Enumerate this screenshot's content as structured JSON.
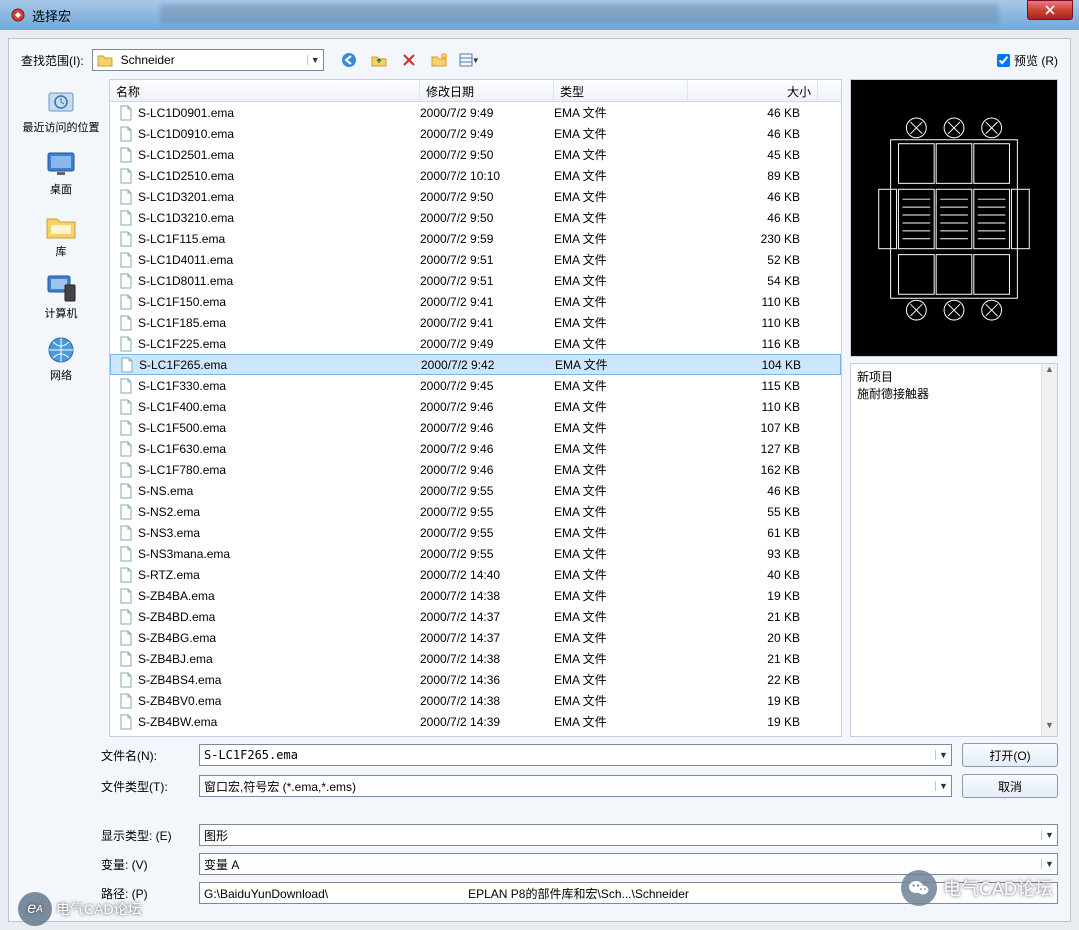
{
  "window": {
    "title": "选择宏"
  },
  "toolbar": {
    "lookin_label": "查找范围(I):",
    "location": "Schneider",
    "preview_label": "预览 (R)",
    "preview_checked": true,
    "icons": {
      "back": "back-icon",
      "up": "up-icon",
      "delete": "delete-icon",
      "newfolder": "newfolder-icon",
      "views": "views-icon"
    }
  },
  "places": [
    {
      "id": "recent",
      "label": "最近访问的位置"
    },
    {
      "id": "desktop",
      "label": "桌面"
    },
    {
      "id": "libraries",
      "label": "库"
    },
    {
      "id": "computer",
      "label": "计算机"
    },
    {
      "id": "network",
      "label": "网络"
    }
  ],
  "columns": {
    "name": "名称",
    "date": "修改日期",
    "type": "类型",
    "size": "大小"
  },
  "files": [
    {
      "name": "S-LC1D0901.ema",
      "date": "2000/7/2 9:49",
      "type": "EMA 文件",
      "size": "46 KB"
    },
    {
      "name": "S-LC1D0910.ema",
      "date": "2000/7/2 9:49",
      "type": "EMA 文件",
      "size": "46 KB"
    },
    {
      "name": "S-LC1D2501.ema",
      "date": "2000/7/2 9:50",
      "type": "EMA 文件",
      "size": "45 KB"
    },
    {
      "name": "S-LC1D2510.ema",
      "date": "2000/7/2 10:10",
      "type": "EMA 文件",
      "size": "89 KB"
    },
    {
      "name": "S-LC1D3201.ema",
      "date": "2000/7/2 9:50",
      "type": "EMA 文件",
      "size": "46 KB"
    },
    {
      "name": "S-LC1D3210.ema",
      "date": "2000/7/2 9:50",
      "type": "EMA 文件",
      "size": "46 KB"
    },
    {
      "name": "S-LC1F115.ema",
      "date": "2000/7/2 9:59",
      "type": "EMA 文件",
      "size": "230 KB"
    },
    {
      "name": "S-LC1D4011.ema",
      "date": "2000/7/2 9:51",
      "type": "EMA 文件",
      "size": "52 KB"
    },
    {
      "name": "S-LC1D8011.ema",
      "date": "2000/7/2 9:51",
      "type": "EMA 文件",
      "size": "54 KB"
    },
    {
      "name": "S-LC1F150.ema",
      "date": "2000/7/2 9:41",
      "type": "EMA 文件",
      "size": "110 KB"
    },
    {
      "name": "S-LC1F185.ema",
      "date": "2000/7/2 9:41",
      "type": "EMA 文件",
      "size": "110 KB"
    },
    {
      "name": "S-LC1F225.ema",
      "date": "2000/7/2 9:49",
      "type": "EMA 文件",
      "size": "116 KB"
    },
    {
      "name": "S-LC1F265.ema",
      "date": "2000/7/2 9:42",
      "type": "EMA 文件",
      "size": "104 KB",
      "selected": true
    },
    {
      "name": "S-LC1F330.ema",
      "date": "2000/7/2 9:45",
      "type": "EMA 文件",
      "size": "115 KB"
    },
    {
      "name": "S-LC1F400.ema",
      "date": "2000/7/2 9:46",
      "type": "EMA 文件",
      "size": "110 KB"
    },
    {
      "name": "S-LC1F500.ema",
      "date": "2000/7/2 9:46",
      "type": "EMA 文件",
      "size": "107 KB"
    },
    {
      "name": "S-LC1F630.ema",
      "date": "2000/7/2 9:46",
      "type": "EMA 文件",
      "size": "127 KB"
    },
    {
      "name": "S-LC1F780.ema",
      "date": "2000/7/2 9:46",
      "type": "EMA 文件",
      "size": "162 KB"
    },
    {
      "name": "S-NS.ema",
      "date": "2000/7/2 9:55",
      "type": "EMA 文件",
      "size": "46 KB"
    },
    {
      "name": "S-NS2.ema",
      "date": "2000/7/2 9:55",
      "type": "EMA 文件",
      "size": "55 KB"
    },
    {
      "name": "S-NS3.ema",
      "date": "2000/7/2 9:55",
      "type": "EMA 文件",
      "size": "61 KB"
    },
    {
      "name": "S-NS3mana.ema",
      "date": "2000/7/2 9:55",
      "type": "EMA 文件",
      "size": "93 KB"
    },
    {
      "name": "S-RTZ.ema",
      "date": "2000/7/2 14:40",
      "type": "EMA 文件",
      "size": "40 KB"
    },
    {
      "name": "S-ZB4BA.ema",
      "date": "2000/7/2 14:38",
      "type": "EMA 文件",
      "size": "19 KB"
    },
    {
      "name": "S-ZB4BD.ema",
      "date": "2000/7/2 14:37",
      "type": "EMA 文件",
      "size": "21 KB"
    },
    {
      "name": "S-ZB4BG.ema",
      "date": "2000/7/2 14:37",
      "type": "EMA 文件",
      "size": "20 KB"
    },
    {
      "name": "S-ZB4BJ.ema",
      "date": "2000/7/2 14:38",
      "type": "EMA 文件",
      "size": "21 KB"
    },
    {
      "name": "S-ZB4BS4.ema",
      "date": "2000/7/2 14:36",
      "type": "EMA 文件",
      "size": "22 KB"
    },
    {
      "name": "S-ZB4BV0.ema",
      "date": "2000/7/2 14:38",
      "type": "EMA 文件",
      "size": "19 KB"
    },
    {
      "name": "S-ZB4BW.ema",
      "date": "2000/7/2 14:39",
      "type": "EMA 文件",
      "size": "19 KB"
    }
  ],
  "desc": {
    "line1": "新项目",
    "line2": "施耐德接触器"
  },
  "bottom": {
    "filename_label": "文件名(N):",
    "filename_value": "S-LC1F265.ema",
    "filetype_label": "文件类型(T):",
    "filetype_value": "窗口宏,符号宏 (*.ema,*.ems)",
    "open_label": "打开(O)",
    "cancel_label": "取消",
    "display_label": "显示类型: (E)",
    "display_value": "图形",
    "variant_label": "变量: (V)",
    "variant_value": "变量 A",
    "path_label": "路径: (P)",
    "path_value": "G:\\BaiduYunDownload\\                                          EPLAN P8的部件库和宏\\Sch...\\Schneider"
  },
  "watermark": {
    "left": "电气CAD论坛",
    "right": "电气CAD论坛"
  }
}
